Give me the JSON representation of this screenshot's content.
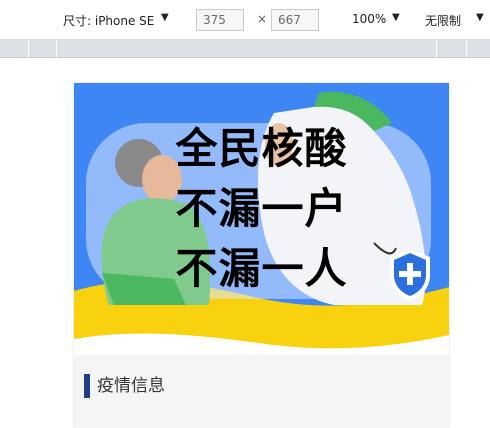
{
  "toolbar": {
    "dimensions_label": "尺寸: iPhone SE",
    "width_value": "375",
    "height_value": "667",
    "times_symbol": "×",
    "zoom_label": "100%",
    "throttle_label": "无限制"
  },
  "banner": {
    "title_lines": [
      "全民核酸",
      "不漏一户",
      "不漏一人"
    ]
  },
  "section": {
    "label": "疫情信息"
  },
  "colors": {
    "banner_blue": "#3f86f5",
    "banner_yellow": "#f8d20f",
    "section_bar": "#1f3d88",
    "shield_blue": "#2b6fe0"
  }
}
